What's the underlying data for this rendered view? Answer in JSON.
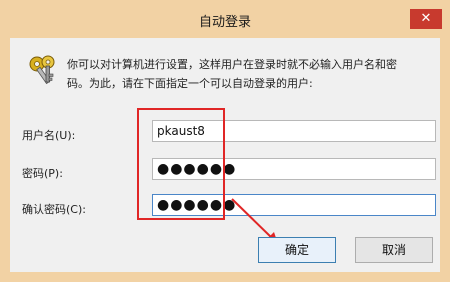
{
  "window": {
    "title": "自动登录",
    "close_glyph": "✕"
  },
  "description": {
    "line1": "你可以对计算机进行设置，这样用户在登录时就不必输入用户名和密",
    "line2": "码。为此，请在下面指定一个可以自动登录的用户:"
  },
  "form": {
    "username_label": "用户名(U):",
    "username_value": "pkaust8",
    "password_label": "密码(P):",
    "password_value": "●●●●●●",
    "confirm_label": "确认密码(C):",
    "confirm_value": "●●●●●●"
  },
  "buttons": {
    "ok": "确定",
    "cancel": "取消"
  },
  "colors": {
    "titlebar": "#f2d2a4",
    "close": "#c83a2e",
    "highlight": "#e02626"
  },
  "icons": {
    "keys": "keys-icon",
    "close": "close-icon"
  }
}
